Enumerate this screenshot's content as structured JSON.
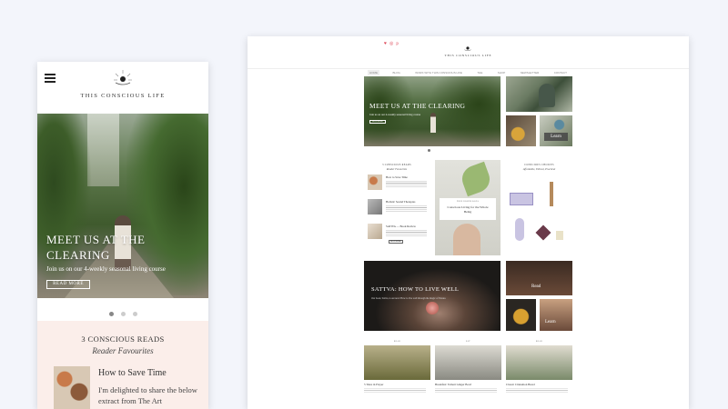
{
  "mobile": {
    "brand": "THIS CONSCIOUS LIFE",
    "hero": {
      "title": "MEET US AT THE CLEARING",
      "subtitle": "Join us on our 4-weekly seasonal living course",
      "button": "READ MORE"
    },
    "reads": {
      "title": "3 CONSCIOUS READS",
      "subtitle": "Reader Favourites",
      "post_title": "How to Save Time",
      "post_text": "I'm delighted to share the below extract from The Art"
    }
  },
  "desktop": {
    "brand": "THIS CONSCIOUS LIFE",
    "nav": [
      "HOME",
      "BLOG",
      "WORK WITH THIS CONSCIOUS LIFE",
      "THE",
      "SHOP",
      "NEWSLETTER",
      "CONTACT"
    ],
    "hero": {
      "title": "MEET US AT THE CLEARING",
      "subtitle": "Join us on our 4-weekly seasonal living course",
      "button": "READ MORE"
    },
    "tile_label": "Learn",
    "reads": {
      "title": "3 CONSCIOUS READS",
      "subtitle": "Reader Favourites",
      "items": [
        "How to Save Time",
        "Holistic Sound Therapies",
        "SATIVA — Book Review"
      ],
      "button": "READ MORE"
    },
    "featured": {
      "tag": "FREE DOWNLOADS",
      "title": "Conscious Living for the Whole Being"
    },
    "eco": {
      "title": "CONSCIOUS CHOICES",
      "subtitle": "Affordable, Ethical, Practical"
    },
    "sattva": {
      "title": "SATTVA: HOW TO LIVE WELL",
      "subtitle": "Our book, Sattva, is out now! How to live well through the magic of Nature."
    },
    "side_labels": {
      "read": "Read",
      "learn": "Learn"
    },
    "bottom": [
      {
        "head": "READ",
        "title": "5 Tales in Prayer"
      },
      {
        "head": "EAT",
        "title": "Breakfast: Tamari Ginger Bowl"
      },
      {
        "head": "READ",
        "title": "Classic Cinnamon Bread"
      }
    ]
  },
  "colors": {
    "background": "#f3f5fb",
    "reads_background": "#fbeeea",
    "social_accent": "#dd4455"
  }
}
